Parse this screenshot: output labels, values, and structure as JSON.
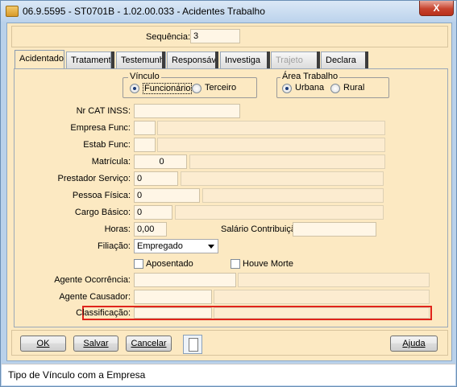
{
  "window": {
    "title": "06.9.5595 - ST0701B - 1.02.00.033 - Acidentes Trabalho",
    "close_glyph": "X"
  },
  "sequencia": {
    "label": "Sequência:",
    "value": "3"
  },
  "tabs": [
    {
      "label": "Acidentado",
      "state": "active"
    },
    {
      "label": "Tratamento",
      "state": "normal"
    },
    {
      "label": "Testemunha",
      "state": "normal"
    },
    {
      "label": "Responsável",
      "state": "normal"
    },
    {
      "label": "Investiga",
      "state": "normal"
    },
    {
      "label": "Trajeto",
      "state": "disabled"
    },
    {
      "label": "Declara",
      "state": "normal"
    }
  ],
  "vinculo": {
    "title": "Vínculo",
    "options": [
      "Funcionário",
      "Terceiro"
    ],
    "selected": "Funcionário"
  },
  "area": {
    "title": "Área Trabalho",
    "options": [
      "Urbana",
      "Rural"
    ],
    "selected": "Urbana"
  },
  "fields": {
    "nr_cat": {
      "label": "Nr CAT INSS:",
      "value": ""
    },
    "empresa": {
      "label": "Empresa Func:",
      "code": "",
      "name": ""
    },
    "estab": {
      "label": "Estab Func:",
      "code": "",
      "name": ""
    },
    "matricula": {
      "label": "Matrícula:",
      "code": "0",
      "name": ""
    },
    "prestador": {
      "label": "Prestador Serviço:",
      "code": "0",
      "name": ""
    },
    "pessoa": {
      "label": "Pessoa Física:",
      "code": "0",
      "name": ""
    },
    "cargo": {
      "label": "Cargo Básico:",
      "code": "0",
      "name": ""
    },
    "horas": {
      "label": "Horas:",
      "value": "0,00"
    },
    "salario": {
      "label": "Salário Contribuição:",
      "value": ""
    },
    "filiacao": {
      "label": "Filiação:",
      "value": "Empregado"
    },
    "aposentado": {
      "label": "Aposentado",
      "checked": false
    },
    "houve_morte": {
      "label": "Houve Morte",
      "checked": false
    },
    "agente_ocorrencia": {
      "label": "Agente Ocorrência:",
      "code": "",
      "name": ""
    },
    "agente_causador": {
      "label": "Agente Causador:",
      "code": "",
      "name": ""
    },
    "classificacao": {
      "label": "Classificação:",
      "code": "",
      "name": ""
    }
  },
  "buttons": {
    "ok": "OK",
    "salvar": "Salvar",
    "cancelar": "Cancelar",
    "ajuda": "Ajuda"
  },
  "status": "Tipo de Vínculo com a Empresa",
  "colors": {
    "panel": "#fce9c2",
    "frame": "#b9d1ea",
    "highlight": "#e0241b"
  }
}
